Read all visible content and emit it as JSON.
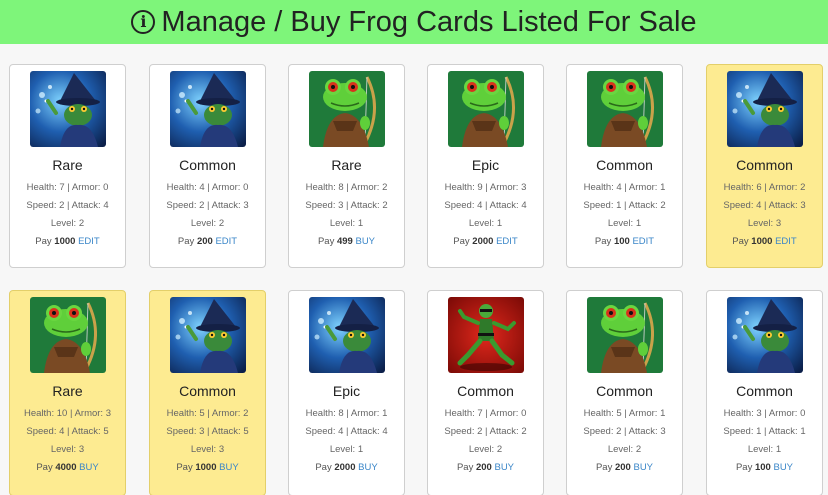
{
  "header": {
    "title": "Manage / Buy Frog Cards Listed For Sale",
    "icon": "info-circle-icon"
  },
  "labels": {
    "health": "Health:",
    "armor": "Armor:",
    "speed": "Speed:",
    "attack": "Attack:",
    "level": "Level:",
    "pay": "Pay"
  },
  "cards": [
    {
      "image": "wizard-frog",
      "rarity": "Rare",
      "health": 7,
      "armor": 0,
      "speed": 2,
      "attack": 4,
      "level": 2,
      "price": 1000,
      "action": "EDIT",
      "highlighted": false
    },
    {
      "image": "wizard-frog",
      "rarity": "Common",
      "health": 4,
      "armor": 0,
      "speed": 2,
      "attack": 3,
      "level": 2,
      "price": 200,
      "action": "EDIT",
      "highlighted": false
    },
    {
      "image": "archer-frog",
      "rarity": "Rare",
      "health": 8,
      "armor": 2,
      "speed": 3,
      "attack": 2,
      "level": 1,
      "price": 499,
      "action": "BUY",
      "highlighted": false
    },
    {
      "image": "archer-frog",
      "rarity": "Epic",
      "health": 9,
      "armor": 3,
      "speed": 4,
      "attack": 4,
      "level": 1,
      "price": 2000,
      "action": "EDIT",
      "highlighted": false
    },
    {
      "image": "archer-frog",
      "rarity": "Common",
      "health": 4,
      "armor": 1,
      "speed": 1,
      "attack": 2,
      "level": 1,
      "price": 100,
      "action": "EDIT",
      "highlighted": false
    },
    {
      "image": "wizard-frog",
      "rarity": "Common",
      "health": 6,
      "armor": 2,
      "speed": 4,
      "attack": 3,
      "level": 3,
      "price": 1000,
      "action": "EDIT",
      "highlighted": true
    },
    {
      "image": "archer-frog",
      "rarity": "Rare",
      "health": 10,
      "armor": 3,
      "speed": 4,
      "attack": 5,
      "level": 3,
      "price": 4000,
      "action": "BUY",
      "highlighted": true
    },
    {
      "image": "wizard-frog",
      "rarity": "Common",
      "health": 5,
      "armor": 2,
      "speed": 3,
      "attack": 5,
      "level": 3,
      "price": 1000,
      "action": "BUY",
      "highlighted": true
    },
    {
      "image": "wizard-frog",
      "rarity": "Epic",
      "health": 8,
      "armor": 1,
      "speed": 4,
      "attack": 4,
      "level": 1,
      "price": 2000,
      "action": "BUY",
      "highlighted": false
    },
    {
      "image": "ninja-frog",
      "rarity": "Common",
      "health": 7,
      "armor": 0,
      "speed": 2,
      "attack": 2,
      "level": 2,
      "price": 200,
      "action": "BUY",
      "highlighted": false
    },
    {
      "image": "archer-frog",
      "rarity": "Common",
      "health": 5,
      "armor": 1,
      "speed": 2,
      "attack": 3,
      "level": 2,
      "price": 200,
      "action": "BUY",
      "highlighted": false
    },
    {
      "image": "wizard-frog",
      "rarity": "Common",
      "health": 3,
      "armor": 0,
      "speed": 1,
      "attack": 1,
      "level": 1,
      "price": 100,
      "action": "BUY",
      "highlighted": false
    }
  ]
}
